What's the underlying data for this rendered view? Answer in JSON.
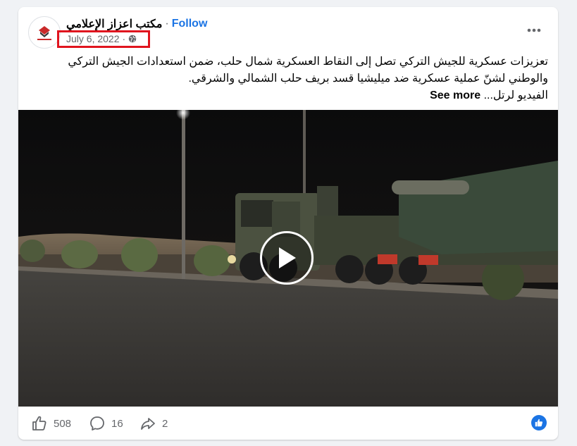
{
  "post": {
    "page_name": "مكتب اعزاز الإعلامي",
    "separator": "·",
    "follow_label": "Follow",
    "date": "July 6, 2022",
    "meta_separator": "·",
    "privacy_icon": "globe-icon",
    "more_icon": "more-options-icon",
    "text_line1": "تعزيزات عسكرية للجيش التركي تصل إلى النقاط العسكرية شمال حلب، ضمن استعدادات الجيش التركي",
    "text_line2": "والوطني لشنّ عملية عسكرية ضد ميليشيا قسد بريف حلب الشمالي والشرقي.",
    "text_line3": "الفيديو لرتل...",
    "see_more_label": "See more"
  },
  "media": {
    "type": "video",
    "play_icon": "play-icon"
  },
  "footer": {
    "like_icon": "thumbs-up-icon",
    "like_count": "508",
    "comment_icon": "comment-icon",
    "comment_count": "16",
    "share_icon": "share-icon",
    "share_count": "2",
    "reaction_icon": "like-reaction-icon"
  },
  "colors": {
    "accent": "#1b74e4",
    "highlight_box": "#e0141e",
    "background": "#f0f2f5"
  }
}
